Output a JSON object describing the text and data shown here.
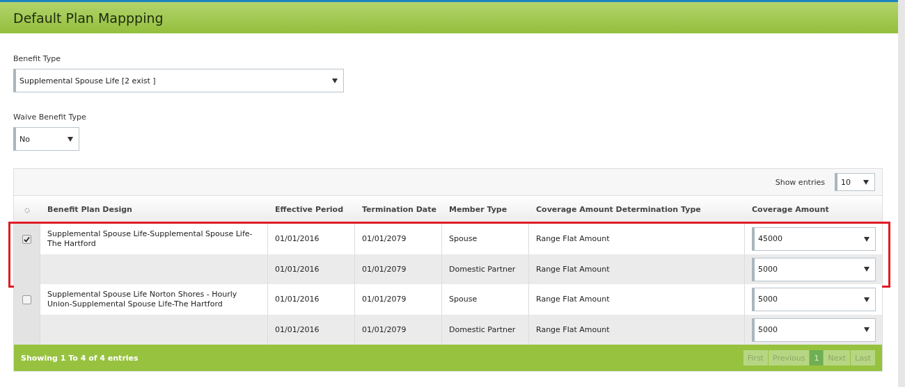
{
  "header": {
    "title": "Default Plan Mappping"
  },
  "fields": [
    {
      "label": "Benefit Type",
      "value": "Supplemental Spouse Life [2 exist ]"
    },
    {
      "label": "Waive Benefit Type",
      "value": "No"
    }
  ],
  "table": {
    "show_entries": {
      "label": "Show entries",
      "value": "10"
    },
    "columns": [
      "Benefit Plan Design",
      "Effective Period",
      "Termination Date",
      "Member Type",
      "Coverage Amount Determination Type",
      "Coverage Amount"
    ],
    "plans": [
      {
        "name": "Supplemental Spouse Life-Supplemental Spouse Life-The Hartford",
        "checked": true,
        "highlighted": true,
        "rows": [
          {
            "effective": "01/01/2016",
            "termination": "01/01/2079",
            "member": "Spouse",
            "determination": "Range Flat Amount",
            "amount": "45000"
          },
          {
            "effective": "01/01/2016",
            "termination": "01/01/2079",
            "member": "Domestic Partner",
            "determination": "Range Flat Amount",
            "amount": "5000"
          }
        ]
      },
      {
        "name": "Supplemental Spouse Life Norton Shores - Hourly Union-Supplemental Spouse Life-The Hartford",
        "checked": false,
        "highlighted": false,
        "rows": [
          {
            "effective": "01/01/2016",
            "termination": "01/01/2079",
            "member": "Spouse",
            "determination": "Range Flat Amount",
            "amount": "5000"
          },
          {
            "effective": "01/01/2016",
            "termination": "01/01/2079",
            "member": "Domestic Partner",
            "determination": "Range Flat Amount",
            "amount": "5000"
          }
        ]
      }
    ],
    "footer": {
      "summary": "Showing 1 To 4 of 4 entries",
      "pages": [
        {
          "label": "First",
          "selected": false,
          "disabled": true
        },
        {
          "label": "Previous",
          "selected": false,
          "disabled": true
        },
        {
          "label": "1",
          "selected": true,
          "disabled": false
        },
        {
          "label": "Next",
          "selected": false,
          "disabled": true
        },
        {
          "label": "Last",
          "selected": false,
          "disabled": true
        }
      ]
    }
  }
}
